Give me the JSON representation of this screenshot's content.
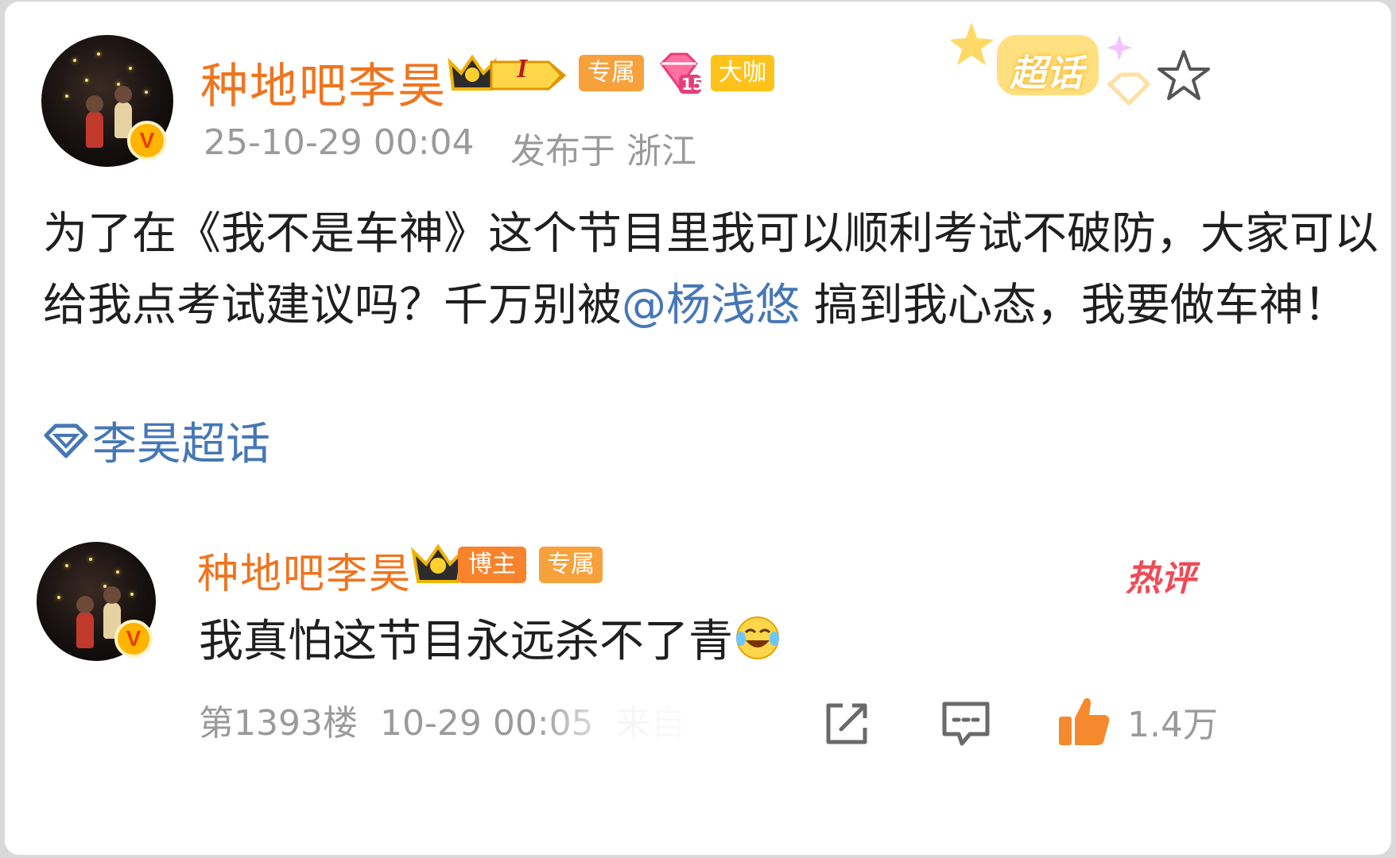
{
  "post": {
    "author": "种地吧李昊",
    "level_badge": "I",
    "tags": [
      "专属",
      "大咖"
    ],
    "gem_level": "15",
    "supertopic_badge": "超话",
    "timestamp": "25-10-29 00:04",
    "location": "发布于 浙江",
    "text_part1": "为了在《我不是车神》这个节目里我可以顺利考试不破防，大家可以给我点考试建议吗？千万别被",
    "mention": "@杨浅悠",
    "text_part2": " 搞到我心态，我要做车神！",
    "topic": "李昊超话"
  },
  "comment": {
    "author": "种地吧李昊",
    "tags": [
      "博主",
      "专属"
    ],
    "hot_label": "热评",
    "text": "我真怕这节目永远杀不了青",
    "emoji": "laughing-crying-emoji",
    "floor": "第1393楼",
    "time": "10-29 00:05",
    "source": "来自",
    "like_count": "1.4万"
  },
  "icons": {
    "star": "star-outline-icon",
    "share": "share-edit-icon",
    "reply": "comment-bubble-icon",
    "like": "thumbs-up-icon"
  },
  "colors": {
    "name_orange": "#f0741e",
    "link_blue": "#4677b5",
    "meta_gray": "#9a9a9a",
    "tag_orange": "#f7a13c",
    "tag_gold": "#ffc21a",
    "hot_red": "#ee4b57",
    "like_orange": "#f5892d"
  }
}
